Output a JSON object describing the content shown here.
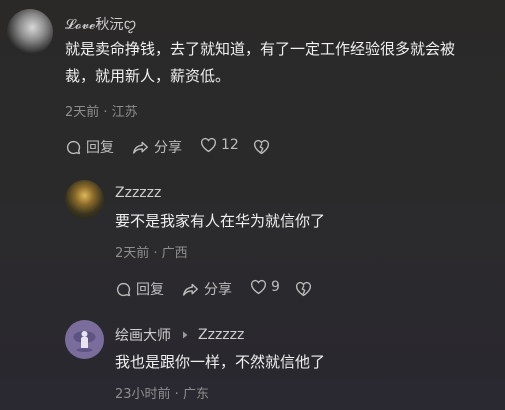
{
  "comments": [
    {
      "user": "𝓛𝓸𝓿𝓮秋沅ꨄ",
      "text_lines": [
        "就是卖命挣钱，去了就知道，有了一定工作经验很多就会被",
        "裁，就用新人，薪资低。"
      ],
      "meta": "2天前 · 江苏",
      "reply_label": "回复",
      "share_label": "分享",
      "like_count": "12"
    },
    {
      "user": "Zzzzzz",
      "text_lines": [
        "要不是我家有人在华为就信你了"
      ],
      "meta": "2天前 · 广西",
      "reply_label": "回复",
      "share_label": "分享",
      "like_count": "9"
    },
    {
      "user": "绘画大师",
      "reply_to": "Zzzzzz",
      "text_lines": [
        "我也是跟你一样，不然就信他了"
      ],
      "meta": "23小时前 · 广东"
    }
  ],
  "colors": {
    "text": "#f0f0f0",
    "secondary": "#8e8e8e",
    "action": "#bdbdbd"
  }
}
